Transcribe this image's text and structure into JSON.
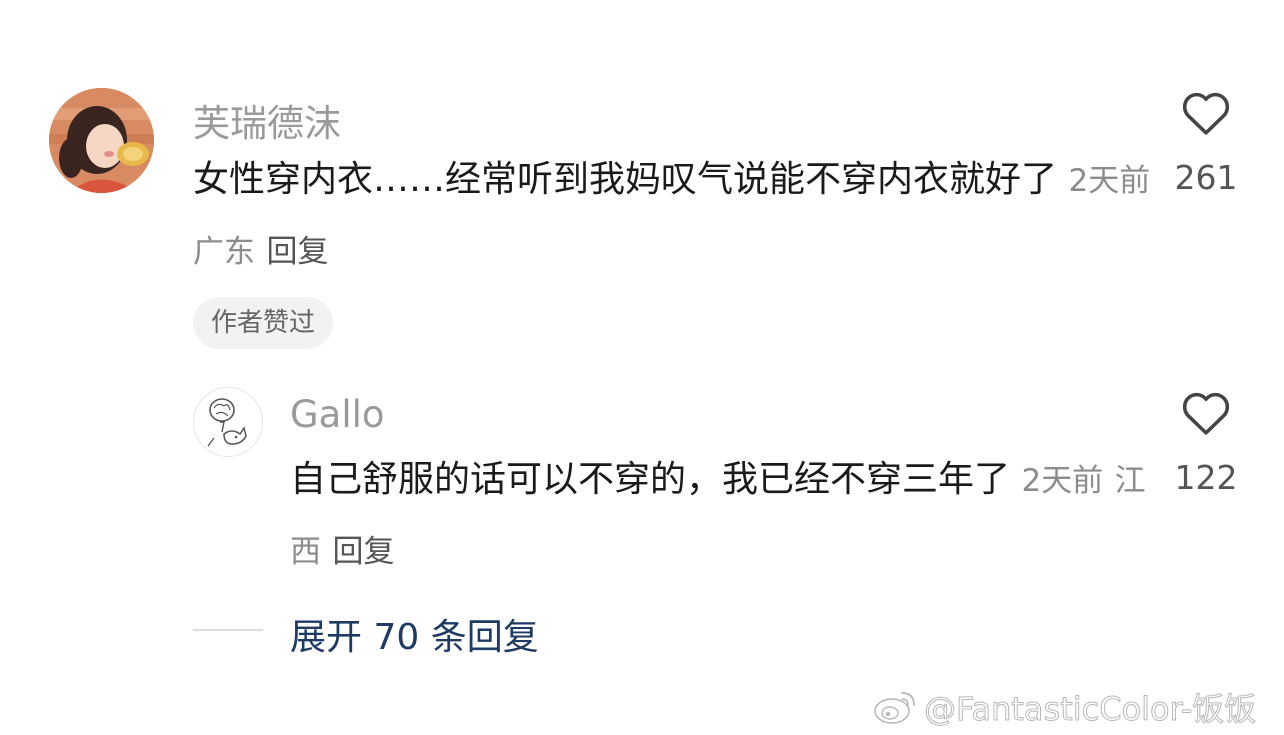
{
  "comment": {
    "username": "芙瑞德沫",
    "text": "女性穿内衣……经常听到我妈叹气说能不穿内衣就好了",
    "time": "2天前",
    "location": "广东",
    "reply_label": "回复",
    "badge": "作者赞过",
    "likes": "261",
    "avatar_icon": "avatar-girl-illustration"
  },
  "reply": {
    "username": "Gallo",
    "text": "自己舒服的话可以不穿的，我已经不穿三年了",
    "time": "2天前",
    "location": "江西",
    "reply_label": "回复",
    "likes": "122",
    "avatar_icon": "avatar-doodle-sketch"
  },
  "expand": {
    "label": "展开 70 条回复"
  },
  "watermark": {
    "text": "@FantasticColor-饭饭"
  },
  "colors": {
    "username": "#9a9a9a",
    "text": "#1a1a1a",
    "meta": "#8c8c8c",
    "expand_link": "#1f3a63",
    "badge_bg": "#f2f2f2"
  }
}
